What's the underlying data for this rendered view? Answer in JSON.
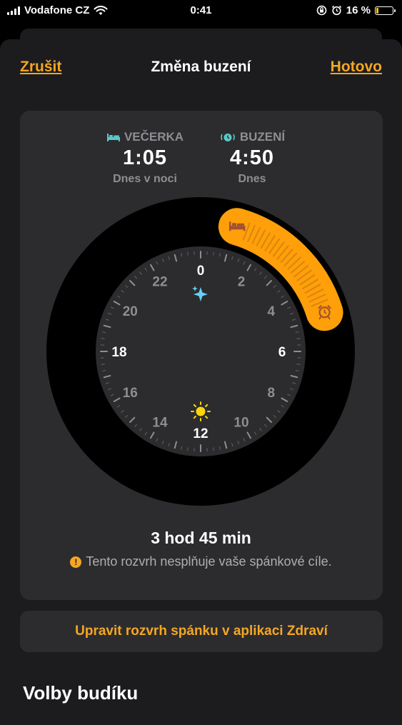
{
  "status_bar": {
    "carrier": "Vodafone CZ",
    "time": "0:41",
    "battery_percent": "16 %",
    "battery_level": 0.16,
    "battery_color": "#f5c518"
  },
  "nav": {
    "cancel": "Zrušit",
    "title": "Změna buzení",
    "done": "Hotovo"
  },
  "bedtime": {
    "label": "VEČERKA",
    "time": "1:05",
    "day": "Dnes v noci",
    "icon": "bed-icon",
    "color": "#5ac8c8"
  },
  "wake": {
    "label": "BUZENÍ",
    "time": "4:50",
    "day": "Dnes",
    "icon": "alarm-icon",
    "color": "#5ac8c8"
  },
  "clock": {
    "hour_labels": [
      "0",
      "2",
      "4",
      "6",
      "8",
      "10",
      "12",
      "14",
      "16",
      "18",
      "20",
      "22"
    ],
    "major_hours": [
      "0",
      "6",
      "12",
      "18"
    ],
    "start_hour": 1.083,
    "end_hour": 4.833,
    "arc_color": "#ff9f0a",
    "icons": [
      "sparkles-icon",
      "sun-icon"
    ]
  },
  "summary": {
    "duration": "3 hod 45 min",
    "warning": "Tento rozvrh nesplňuje vaše spánkové cíle."
  },
  "edit_schedule_button": "Upravit rozvrh spánku v aplikaci Zdraví",
  "section_title": "Volby budíku",
  "colors": {
    "accent": "#f5a623",
    "background": "#1c1c1e",
    "panel": "#2c2c2e"
  }
}
